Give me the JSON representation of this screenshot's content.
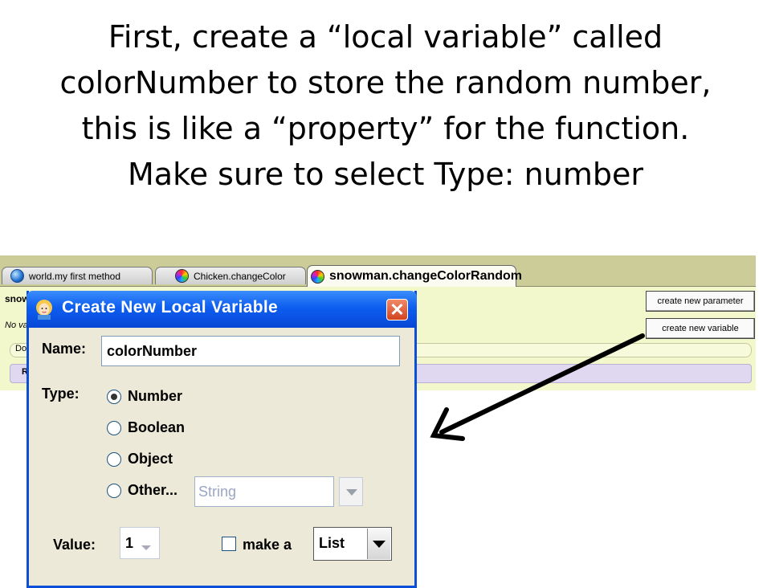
{
  "slide": {
    "title_lines": [
      "First, create a “local variable” called",
      "colorNumber to store the random number,",
      "this is like a “property” for the function.",
      "Make sure to select Type: number"
    ]
  },
  "editor": {
    "tabs": [
      {
        "label": "world.my first method",
        "icon": "blue-ball-icon"
      },
      {
        "label": "Chicken.changeColor",
        "icon": "color-wheel-icon"
      },
      {
        "label": "snowman.changeColorRandom",
        "icon": "color-wheel-icon",
        "active": true
      }
    ],
    "method_header_fragment": "snow",
    "no_vars_fragment": "No va",
    "do_fragment": "Do",
    "lower_fragment": "R",
    "create_parameter_label": "create new parameter",
    "create_variable_label": "create new variable"
  },
  "dialog": {
    "title": "Create New Local Variable",
    "name_label": "Name:",
    "name_value": "colorNumber",
    "type_label": "Type:",
    "types": [
      {
        "label": "Number",
        "selected": true
      },
      {
        "label": "Boolean",
        "selected": false
      },
      {
        "label": "Object",
        "selected": false
      },
      {
        "label": "Other...",
        "selected": false
      }
    ],
    "other_value": "String",
    "value_label": "Value:",
    "value": "1",
    "make_list_label": "make a",
    "list_value": "List"
  },
  "colors": {
    "dialog_titlebar": "#0d5ef0",
    "editor_background": "#f3f7cc",
    "tabbar": "#cccc99",
    "arrow": "#000000"
  }
}
